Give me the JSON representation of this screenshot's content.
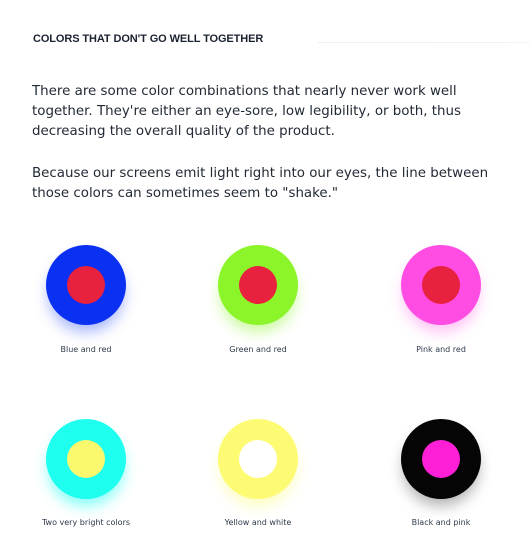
{
  "section": {
    "title": "COLORS THAT DON'T GO WELL TOGETHER"
  },
  "paragraphs": {
    "p1": "There are some color combinations that nearly never work well together. They're either an eye-sore, low legibility, or both, thus decreasing the overall quality of the product.",
    "p2": "Because our screens emit light right into our eyes, the line between those colors can sometimes seem to \"shake.\""
  },
  "swatches": [
    {
      "label": "Blue and red",
      "outer": "#0a30f2",
      "inner": "#e8213f",
      "glow": "rgba(10,48,242,0.35)"
    },
    {
      "label": "Green and red",
      "outer": "#8cf52a",
      "inner": "#e8213f",
      "glow": "rgba(140,245,42,0.45)"
    },
    {
      "label": "Pink and red",
      "outer": "#ff4de3",
      "inner": "#e8213f",
      "glow": "rgba(255,77,227,0.35)"
    },
    {
      "label": "Two very bright colors",
      "outer": "#1ffff0",
      "inner": "#fcf86e",
      "glow": "rgba(31,255,240,0.55)"
    },
    {
      "label": "Yellow and white",
      "outer": "#fdfb73",
      "inner": "#ffffff",
      "glow": "rgba(253,251,115,0.45)"
    },
    {
      "label": "Black and pink",
      "outer": "#050505",
      "inner": "#ff1fd6",
      "glow": "rgba(0,0,0,0.30)"
    }
  ]
}
